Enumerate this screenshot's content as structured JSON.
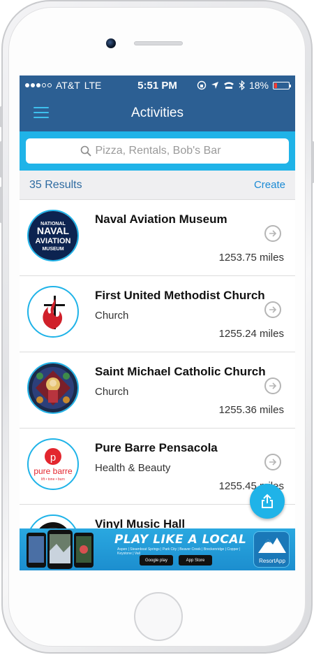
{
  "status": {
    "carrier": "AT&T",
    "network": "LTE",
    "time": "5:51 PM",
    "battery": "18%",
    "battery_level": 0.18
  },
  "nav": {
    "title": "Activities"
  },
  "search": {
    "placeholder": "Pizza, Rentals, Bob's Bar"
  },
  "results": {
    "count_label": "35 Results",
    "create_label": "Create"
  },
  "items": [
    {
      "name": "Naval Aviation Museum",
      "category": "",
      "distance": "1253.75 miles",
      "icon": "naval-aviation-museum-logo"
    },
    {
      "name": "First United Methodist Church",
      "category": "Church",
      "distance": "1255.24 miles",
      "icon": "cross-and-flame-logo"
    },
    {
      "name": "Saint Michael Catholic Church",
      "category": "Church",
      "distance": "1255.36 miles",
      "icon": "stained-glass-logo"
    },
    {
      "name": "Pure Barre Pensacola",
      "category": "Health & Beauty",
      "distance": "1255.45 miles",
      "icon": "pure-barre-logo"
    },
    {
      "name": "Vinyl Music Hall",
      "category": "",
      "distance": "",
      "icon": "vinyl-music-hall-logo"
    }
  ],
  "logos": {
    "naval_line1": "NATIONAL",
    "naval_line2": "NAVAL",
    "naval_line3": "AVIATION",
    "naval_line4": "MUSEUM",
    "pure_barre_letter": "p",
    "pure_barre_text": "pure barre",
    "pure_barre_tagline": "lift • tone • burn"
  },
  "banner": {
    "headline": "PLAY LIKE A LOCAL",
    "subtext": "Aspen | Steamboat Springs | Park City | Beaver Creek | Breckenridge | Copper | Keystone | Vail",
    "google_play": "Google play",
    "app_store": "App Store",
    "brand": "ResortApp"
  },
  "colors": {
    "nav_blue": "#2c5f93",
    "accent_cyan": "#1fb3e8",
    "link_blue": "#1a8ad4"
  }
}
